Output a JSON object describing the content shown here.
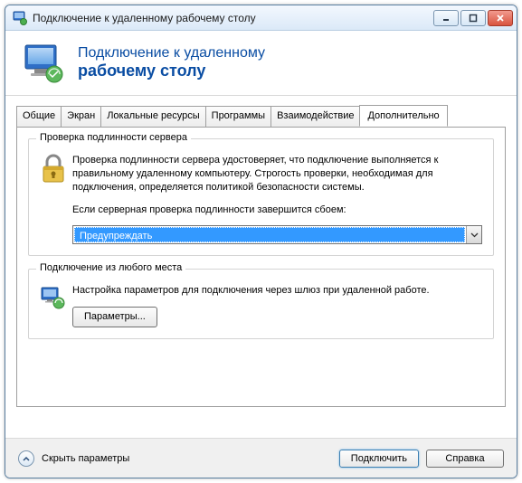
{
  "window": {
    "title": "Подключение к удаленному рабочему столу"
  },
  "header": {
    "line1": "Подключение к удаленному",
    "line2": "рабочему столу"
  },
  "tabs": {
    "t0": "Общие",
    "t1": "Экран",
    "t2": "Локальные ресурсы",
    "t3": "Программы",
    "t4": "Взаимодействие",
    "t5": "Дополнительно"
  },
  "group1": {
    "title": "Проверка подлинности сервера",
    "p1": "Проверка подлинности сервера удостоверяет, что подключение выполняется к правильному удаленному компьютеру. Строгость проверки, необходимая для подключения, определяется политикой безопасности системы.",
    "p2": "Если серверная проверка подлинности завершится сбоем:",
    "dropdown_value": "Предупреждать"
  },
  "group2": {
    "title": "Подключение из любого места",
    "p1": "Настройка параметров для подключения через шлюз при удаленной работе.",
    "button": "Параметры..."
  },
  "footer": {
    "collapse": "Скрыть параметры",
    "connect": "Подключить",
    "help": "Справка"
  }
}
